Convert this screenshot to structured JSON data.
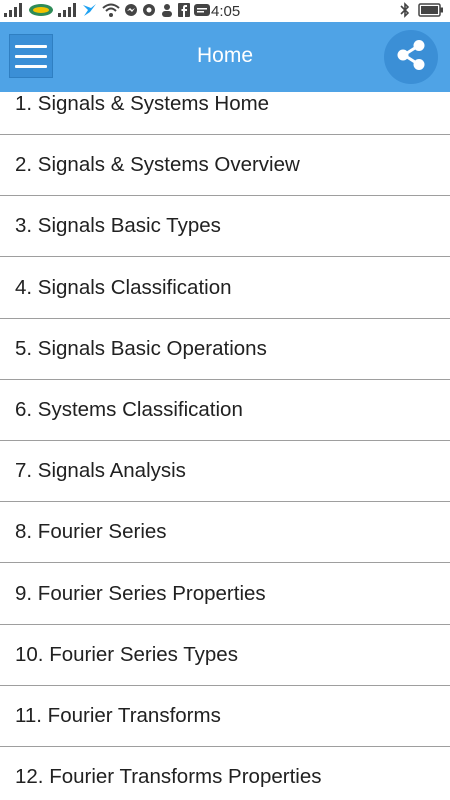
{
  "status_bar": {
    "time": "4:05",
    "carrier_icon": "carrier-logo-icon",
    "icons_left": [
      "signal-icon",
      "carrier-logo-icon",
      "signal-icon",
      "twitter-icon",
      "wifi-icon",
      "messenger-icon",
      "notification-icon",
      "person-icon",
      "facebook-icon",
      "zalo-icon"
    ],
    "icons_right": [
      "bluetooth-icon",
      "battery-icon"
    ]
  },
  "app_bar": {
    "title": "Home",
    "background_color": "#4fa3e6",
    "button_color": "#3b8fd6",
    "menu_icon": "hamburger-menu-icon",
    "share_icon": "share-icon"
  },
  "topics": [
    {
      "label": "1. Signals & Systems Home"
    },
    {
      "label": "2. Signals & Systems Overview"
    },
    {
      "label": "3. Signals Basic Types"
    },
    {
      "label": "4. Signals Classification"
    },
    {
      "label": "5. Signals Basic Operations"
    },
    {
      "label": "6. Systems Classification"
    },
    {
      "label": "7. Signals Analysis"
    },
    {
      "label": "8. Fourier Series"
    },
    {
      "label": "9. Fourier Series Properties"
    },
    {
      "label": "10. Fourier Series Types"
    },
    {
      "label": "11. Fourier Transforms"
    },
    {
      "label": "12. Fourier Transforms Properties"
    }
  ]
}
